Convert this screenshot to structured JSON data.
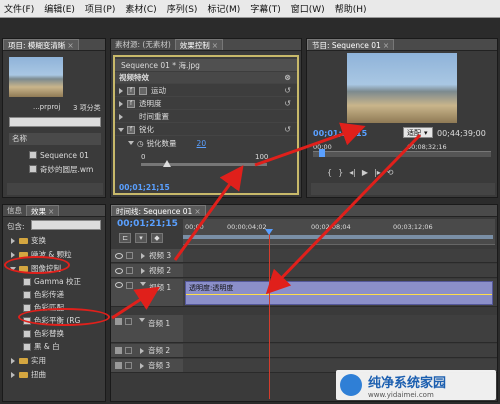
{
  "menu": [
    "文件(F)",
    "编辑(E)",
    "项目(P)",
    "素材(C)",
    "序列(S)",
    "标记(M)",
    "字幕(T)",
    "窗口(W)",
    "帮助(H)"
  ],
  "project_panel": {
    "tab": "项目: 模糊变清晰",
    "file_name": "...prproj",
    "item_count": "3 项分类",
    "column_header": "名称",
    "items": [
      {
        "name": "Sequence 01"
      },
      {
        "name": "奇妙的圆层.wm"
      }
    ]
  },
  "source_panel": {
    "tab_source": "素材源: (无素材)",
    "tab_effect": "效果控制"
  },
  "effect_controls": {
    "clip": "Sequence 01 * 海.jpg",
    "section": "视频特效",
    "effects": [
      "运动",
      "透明度",
      "时间重置"
    ],
    "sharpen": "锐化",
    "param_label": "锐化数量",
    "param_value": "20",
    "slider_min": "0",
    "slider_max": "100",
    "timecode": "00;01;21;15"
  },
  "program_monitor": {
    "tab": "节目: Sequence 01",
    "timecode_current": "00;01;21;15",
    "fit_option": "适配",
    "timecode_duration": "00;44;39;00",
    "ruler_marks": [
      "00;00",
      "00;08;32;16"
    ]
  },
  "effects_panel": {
    "tab_info": "信息",
    "tab_effects": "效果",
    "contains_label": "包含:",
    "folders": [
      "变换",
      "噪波 & 颗粒",
      "图像控制",
      "实用",
      "扭曲"
    ],
    "image_control_items": [
      "Gamma 校正",
      "色彩传递",
      "色彩匹配",
      "色彩平衡 (RG",
      "色彩替换",
      "黑 & 白"
    ]
  },
  "timeline": {
    "tab": "时间线: Sequence 01",
    "timecode": "00;01;21;15",
    "ruler_labels": [
      "00;00",
      "00;00;04;02",
      "00;02;08;04",
      "00;03;12;06"
    ],
    "video_tracks": [
      "视频 3",
      "视频 2",
      "视频 1"
    ],
    "clip_label": "透明度:透明度",
    "audio_tracks": [
      "音频 1",
      "音频 2",
      "音频 3"
    ]
  },
  "watermark": {
    "title": "纯净系统家园",
    "url": "www.yidaimei.com"
  },
  "colors": {
    "highlight_ring": "#e0201b",
    "timecode": "#5aa0ff",
    "playhead": "#d43c2c",
    "effect_panel_border": "#c8b96a"
  }
}
